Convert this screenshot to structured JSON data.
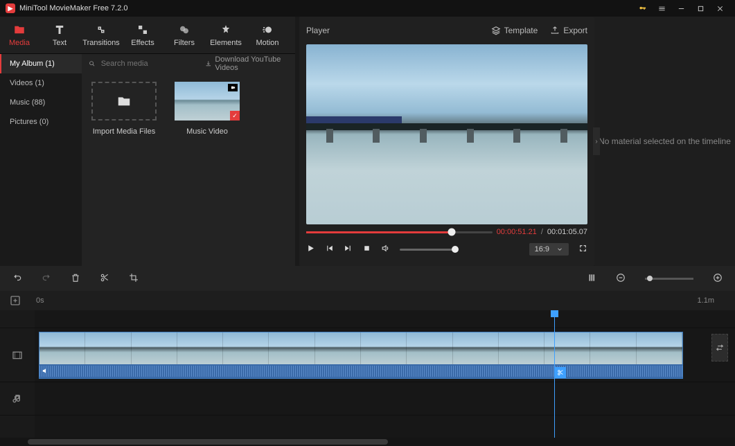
{
  "app": {
    "title": "MiniTool MovieMaker Free 7.2.0"
  },
  "toolbar": [
    {
      "label": "Media",
      "active": true
    },
    {
      "label": "Text"
    },
    {
      "label": "Transitions"
    },
    {
      "label": "Effects"
    },
    {
      "label": "Filters"
    },
    {
      "label": "Elements"
    },
    {
      "label": "Motion"
    }
  ],
  "sidebar": [
    {
      "label": "My Album (1)",
      "active": true
    },
    {
      "label": "Videos (1)"
    },
    {
      "label": "Music (88)"
    },
    {
      "label": "Pictures (0)"
    }
  ],
  "search": {
    "placeholder": "Search media",
    "download": "Download YouTube Videos"
  },
  "mediacards": {
    "import": "Import Media Files",
    "item1": "Music Video"
  },
  "preview": {
    "title": "Player",
    "template": "Template",
    "export": "Export",
    "current_time": "00:00:51.21",
    "total_time": "00:01:05.07",
    "aspect": "16:9"
  },
  "rightpanel": {
    "message": "No material selected on the timeline"
  },
  "ruler": {
    "start": "0s",
    "end": "1.1m"
  }
}
